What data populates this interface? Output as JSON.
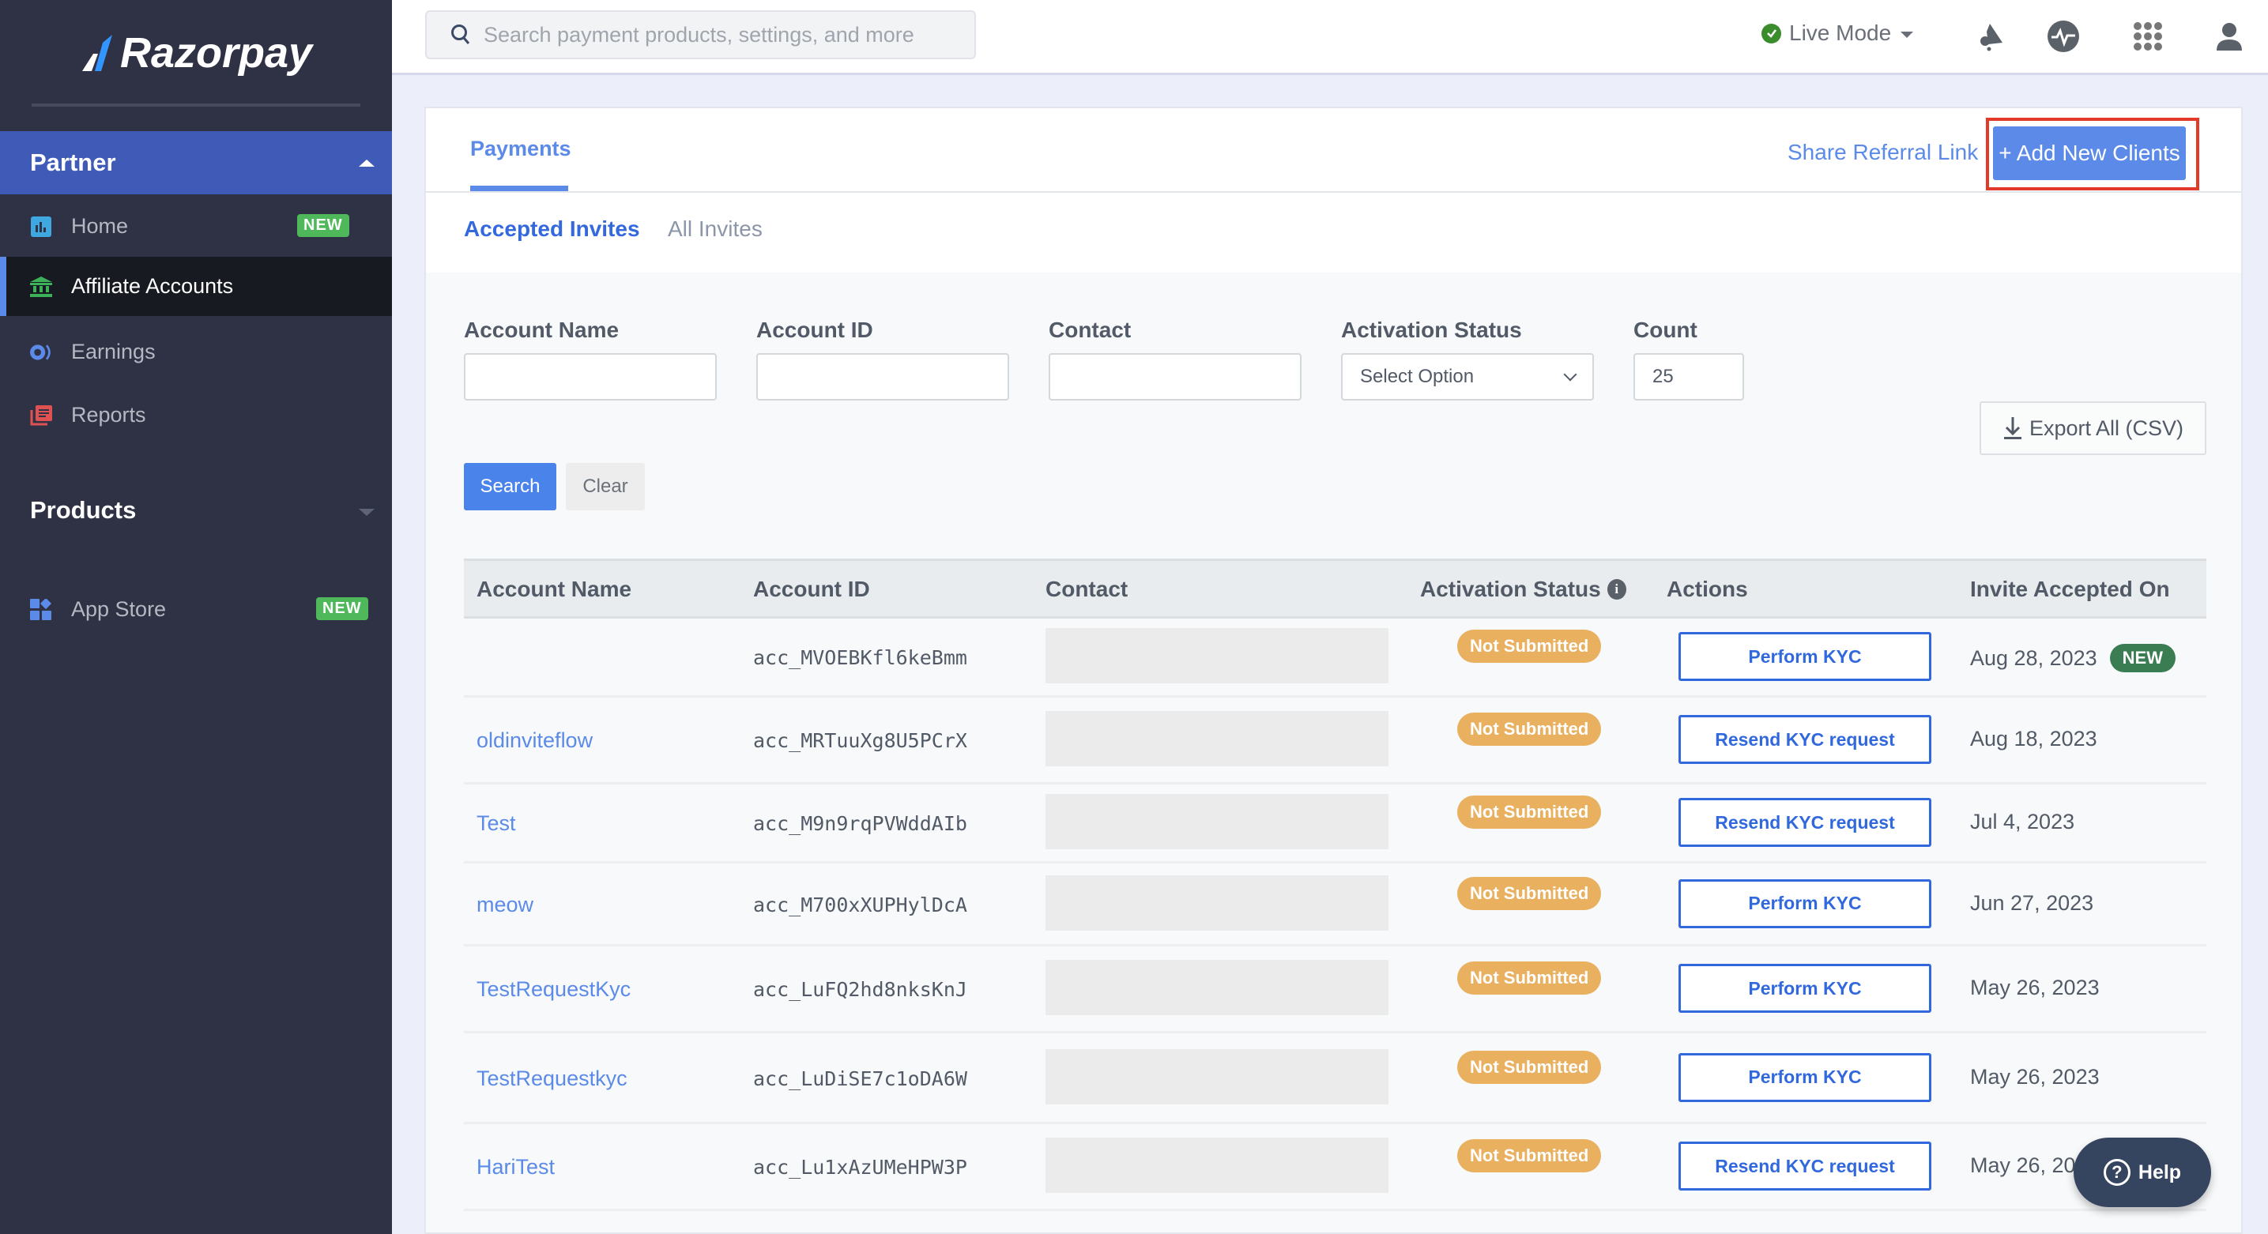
{
  "brand": {
    "name": "Razorpay",
    "accent": "#3395ff"
  },
  "sidebar": {
    "partner_section": "Partner",
    "items": [
      {
        "label": "Home",
        "badge": "NEW",
        "icon": "bar-chart-icon",
        "color": "#3fa8e0"
      },
      {
        "label": "Affiliate Accounts",
        "badge": null,
        "icon": "bank-icon",
        "color": "#3db15a",
        "active": true
      },
      {
        "label": "Earnings",
        "badge": null,
        "icon": "earnings-icon",
        "color": "#5b8ae8"
      },
      {
        "label": "Reports",
        "badge": null,
        "icon": "reports-icon",
        "color": "#e05252"
      }
    ],
    "products_section": "Products",
    "app_store": {
      "label": "App Store",
      "badge": "NEW",
      "icon": "app-store-icon"
    }
  },
  "topbar": {
    "search_placeholder": "Search payment products, settings, and more",
    "mode_label": "Live Mode",
    "icons": [
      "announcement-icon",
      "activity-icon",
      "apps-grid-icon",
      "user-icon"
    ]
  },
  "card": {
    "tab": "Payments",
    "share_link": "Share Referral Link",
    "add_button": "+ Add New Clients",
    "subtabs": {
      "active": "Accepted Invites",
      "inactive": "All Invites"
    }
  },
  "filters": {
    "account_name": {
      "label": "Account Name",
      "value": ""
    },
    "account_id": {
      "label": "Account ID",
      "value": ""
    },
    "contact": {
      "label": "Contact",
      "value": ""
    },
    "activation_status": {
      "label": "Activation Status",
      "value": "Select Option"
    },
    "count": {
      "label": "Count",
      "value": "25"
    },
    "export_label": "Export All (CSV)",
    "search_label": "Search",
    "clear_label": "Clear"
  },
  "table": {
    "headers": [
      "Account Name",
      "Account ID",
      "Contact",
      "Activation Status",
      "Actions",
      "Invite Accepted On"
    ],
    "rows": [
      {
        "name": "",
        "id": "acc_MVOEBKfl6keBmm",
        "status": "Not Submitted",
        "action": "Perform KYC",
        "date": "Aug 28, 2023",
        "new": "NEW"
      },
      {
        "name": "oldinviteflow",
        "id": "acc_MRTuuXg8U5PCrX",
        "status": "Not Submitted",
        "action": "Resend KYC request",
        "date": "Aug 18, 2023"
      },
      {
        "name": "Test",
        "id": "acc_M9n9rqPVWddAIb",
        "status": "Not Submitted",
        "action": "Resend KYC request",
        "date": "Jul 4, 2023"
      },
      {
        "name": "meow",
        "id": "acc_M700xXUPHylDcA",
        "status": "Not Submitted",
        "action": "Perform KYC",
        "date": "Jun 27, 2023"
      },
      {
        "name": "TestRequestKyc",
        "id": "acc_LuFQ2hd8nksKnJ",
        "status": "Not Submitted",
        "action": "Perform KYC",
        "date": "May 26, 2023"
      },
      {
        "name": "TestRequestkyc",
        "id": "acc_LuDiSE7c1oDA6W",
        "status": "Not Submitted",
        "action": "Perform KYC",
        "date": "May 26, 2023"
      },
      {
        "name": "HariTest",
        "id": "acc_Lu1xAzUMeHPW3P",
        "status": "Not Submitted",
        "action": "Resend KYC request",
        "date": "May 26, 202"
      }
    ]
  },
  "help": {
    "label": "Help"
  }
}
